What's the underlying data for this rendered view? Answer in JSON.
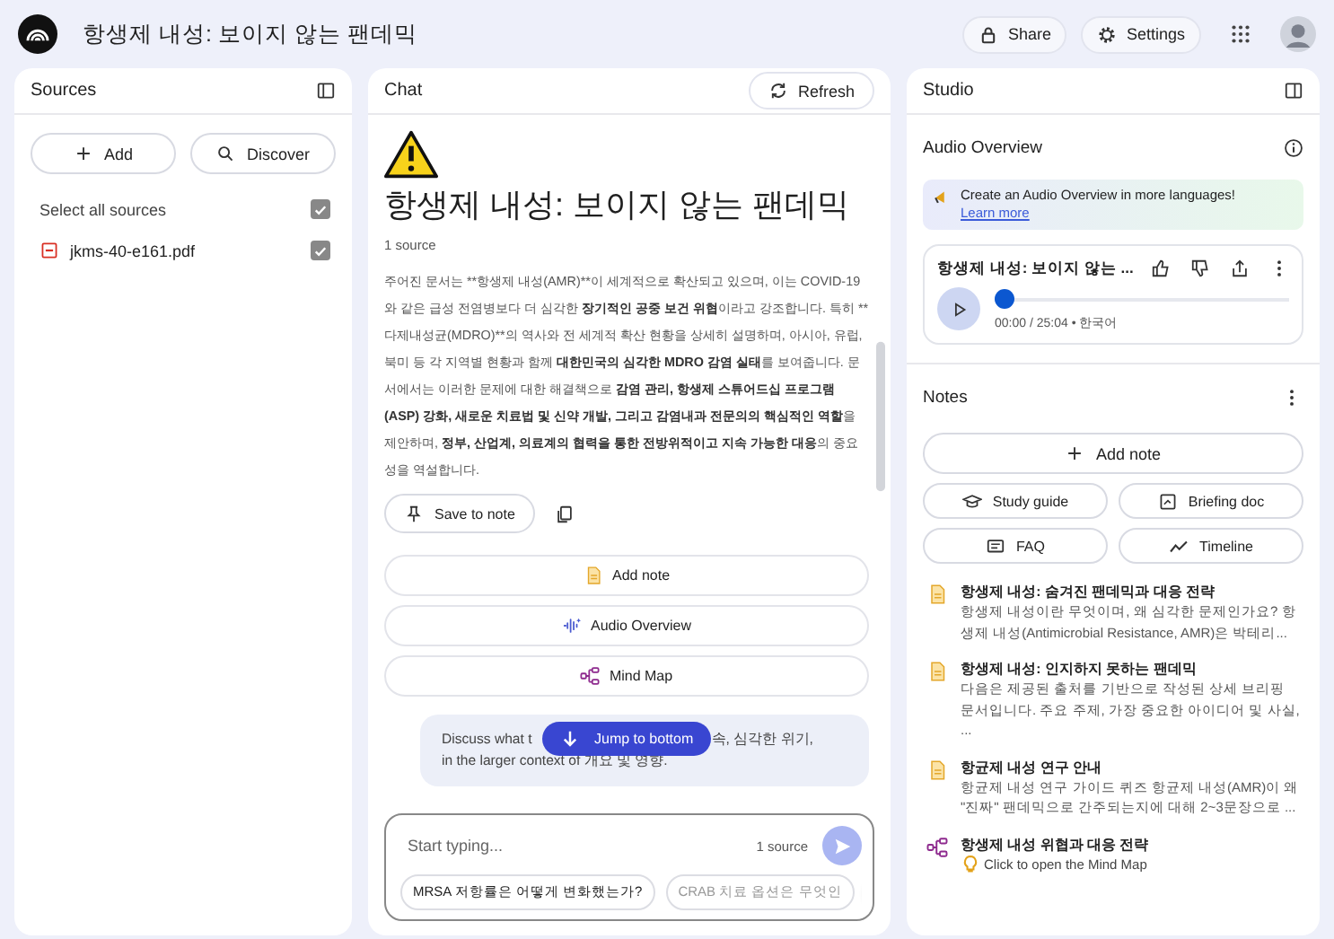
{
  "app_bar": {
    "title": "항생제 내성: 보이지 않는 팬데믹",
    "buttons": [
      {
        "kind": "share",
        "label": "Share"
      },
      {
        "kind": "settings",
        "label": "Settings"
      }
    ]
  },
  "sources": {
    "title": "Sources",
    "buttons": [
      {
        "kind": "add",
        "label": "Add"
      },
      {
        "kind": "discover",
        "label": "Discover"
      }
    ],
    "select_all": {
      "label": "Select all sources",
      "checked": true
    },
    "items": [
      {
        "name": "jkms-40-e161.pdf",
        "checked": true
      }
    ]
  },
  "chat": {
    "title": "Chat",
    "refresh": "Refresh",
    "heading": "항생제 내성: 보이지 않는 팬데믹",
    "source_count": "1 source",
    "summary": [
      {
        "text": "주어진 문서는 **항생제 내성(AMR)**이 세계적으로 확산되고 있으며, 이는 COVID-19와 같은 급성 전염병보다 더 심각한 ",
        "bold": false
      },
      {
        "text": "장기적인 공중 보건 위협",
        "bold": true
      },
      {
        "text": "이라고 강조합니다. 특히 **다제내성균(MDRO)**의 역사와 전 세계적 확산 현황을 상세히 설명하며, 아시아, 유럽, 북미 등 각 지역별 현황과 함께 ",
        "bold": false
      },
      {
        "text": "대한민국의 심각한 MDRO 감염 실태",
        "bold": true
      },
      {
        "text": "를 보여줍니다. 문서에서는 이러한 문제에 대한 해결책으로 ",
        "bold": false
      },
      {
        "text": "감염 관리, 항생제 스튜어드십 프로그램(ASP) 강화, 새로운 치료법 및 신약 개발, 그리고 감염내과 전문의의 핵심적인 역할",
        "bold": true
      },
      {
        "text": "을 제안하며, ",
        "bold": false
      },
      {
        "text": "정부, 산업계, 의료계의 협력을 통한 전방위적이고 지속 가능한 대응",
        "bold": true
      },
      {
        "text": "의 중요성을 역설합니다.",
        "bold": false
      }
    ],
    "save_to_note": "Save to note",
    "actions": [
      {
        "kind": "note",
        "label": "Add note"
      },
      {
        "kind": "audio",
        "label": "Audio Overview"
      },
      {
        "kind": "mindmap",
        "label": "Mind Map"
      }
    ],
    "suggestion": {
      "start": "Discuss what t",
      "end": "속, 심각한 위기,",
      "line_2": "in the larger context of 개요 및 영향."
    },
    "jump": "Jump to bottom",
    "input": {
      "placeholder": "Start typing...",
      "source_count": "1 source"
    },
    "chips": [
      {
        "label": "MRSA 저항률은 어떻게 변화했는가?",
        "faded": false
      },
      {
        "label": "CRAB 치료 옵션은 무엇인",
        "faded": true
      }
    ]
  },
  "studio": {
    "title": "Studio",
    "audio_overview": {
      "title": "Audio Overview",
      "banner": "Create an Audio Overview in more languages! ",
      "banner_link": "Learn more",
      "track": {
        "title": "항생제 내성: 보이지 않는 ...",
        "level": 0,
        "time": "00:00 / 25:04 • 한국어"
      }
    },
    "notes": {
      "title": "Notes",
      "add": "Add note",
      "tools": [
        {
          "kind": "study",
          "label": "Study guide"
        },
        {
          "kind": "briefing",
          "label": "Briefing doc"
        },
        {
          "kind": "faq",
          "label": "FAQ"
        },
        {
          "kind": "timeline",
          "label": "Timeline"
        }
      ],
      "items": [
        {
          "kind": "note",
          "title": "항생제 내성: 숨겨진 팬데믹과 대응 전략",
          "preview": "항생제 내성이란 무엇이며, 왜 심각한 문제인가요? 항생제 내성(Antimicrobial Resistance, AMR)은 박테리..."
        },
        {
          "kind": "note",
          "title": "항생제 내성: 인지하지 못하는 팬데믹",
          "preview": "다음은 제공된 출처를 기반으로 작성된 상세 브리핑 문서입니다. 주요 주제, 가장 중요한 아이디어 및 사실, ..."
        },
        {
          "kind": "note",
          "title": "항균제 내성 연구 안내",
          "preview": "항균제 내성 연구 가이드 퀴즈 항균제 내성(AMR)이 왜 \"진짜\" 팬데믹으로 간주되는지에 대해 2~3문장으로 ..."
        },
        {
          "kind": "mindmap",
          "title": "항생제 내성 위협과 대응 전략",
          "preview": "Click to open the Mind Map"
        }
      ]
    }
  }
}
